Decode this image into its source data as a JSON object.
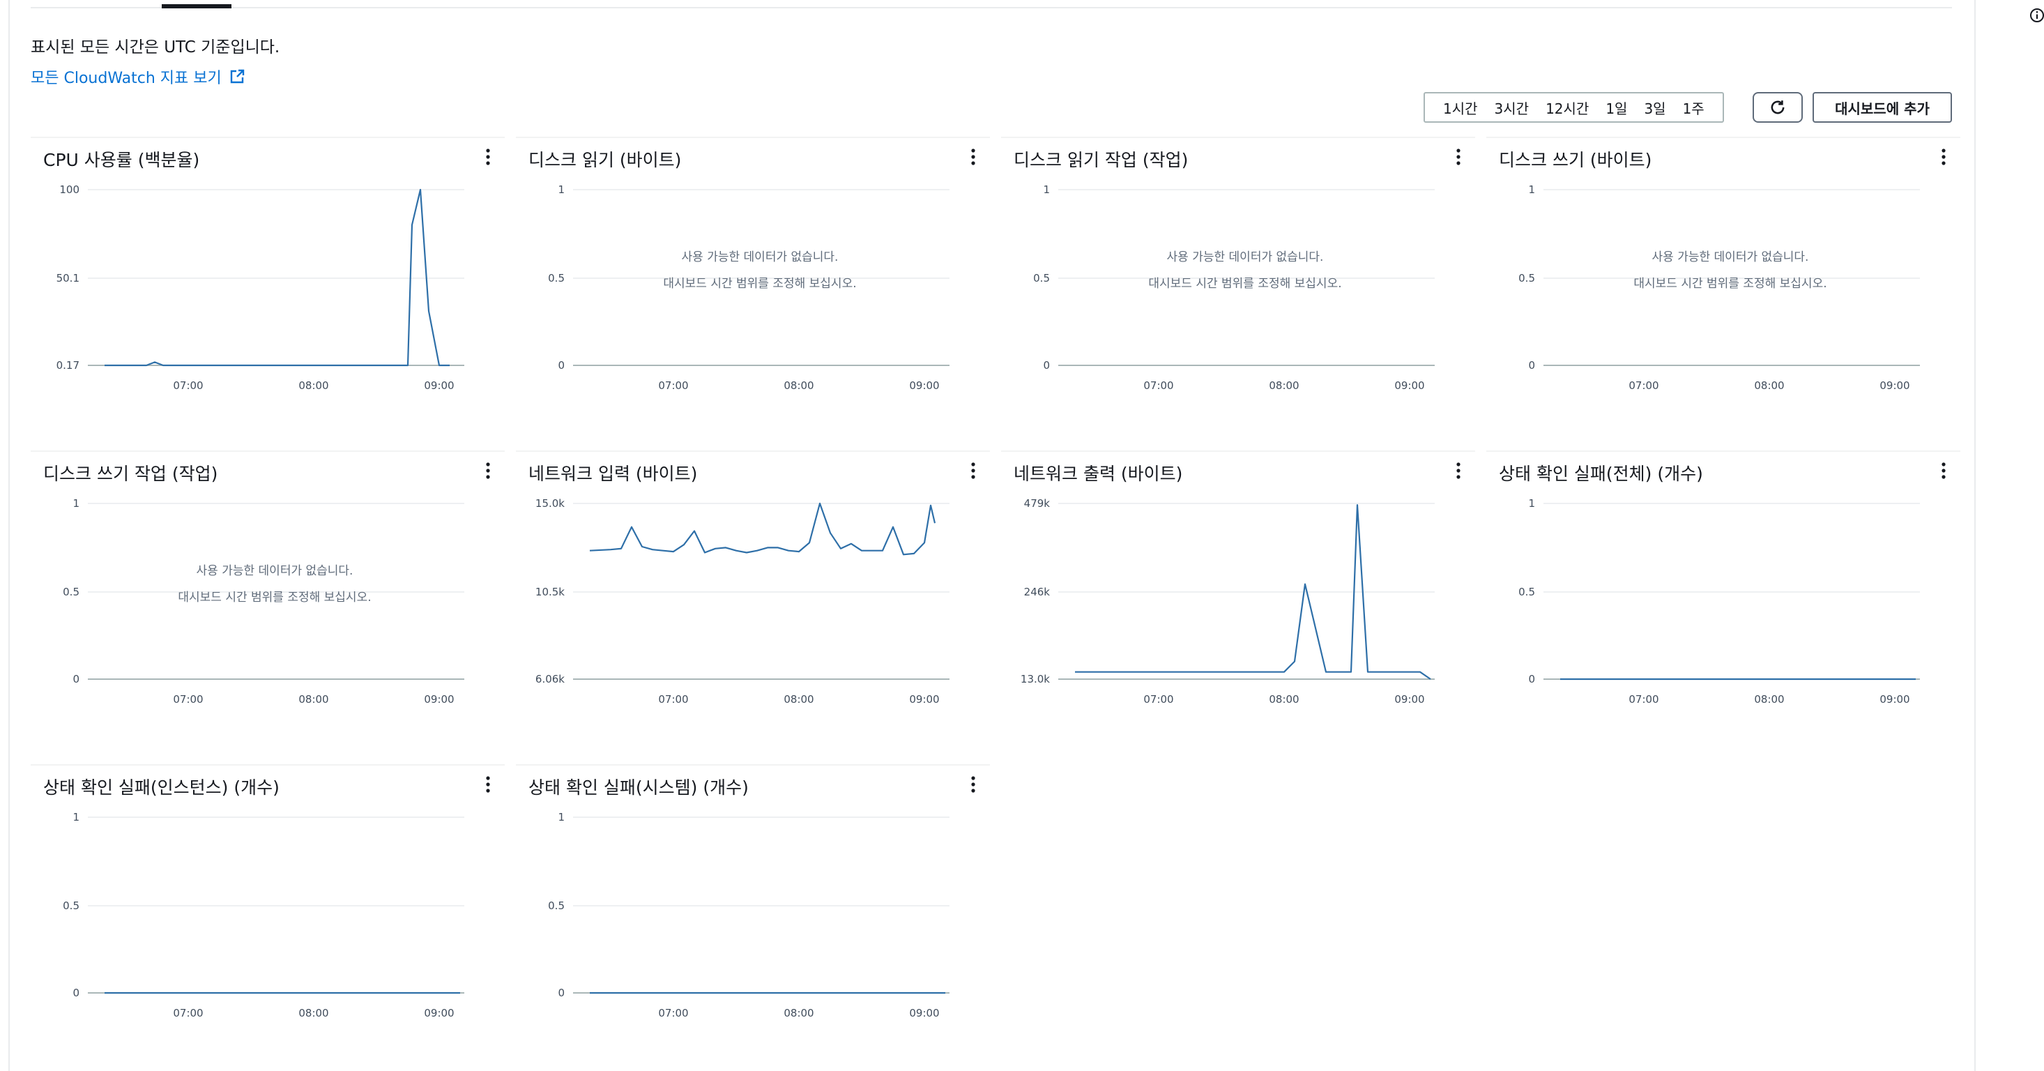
{
  "header": {
    "utc_note": "표시된 모든 시간은 UTC 기준입니다.",
    "all_metrics_link": "모든 CloudWatch 지표 보기"
  },
  "time_range": {
    "options": [
      "1시간",
      "3시간",
      "12시간",
      "1일",
      "3일",
      "1주"
    ]
  },
  "toolbar": {
    "refresh_icon": "refresh-icon",
    "add_to_dashboard_label": "대시보드에 추가"
  },
  "nodata_messages": [
    "사용 가능한 데이터가 없습니다.",
    "대시보드 시간 범위를 조정해 보십시오."
  ],
  "colors": {
    "series": "#2e6fa8",
    "link": "#0972d3",
    "text": "#16191f",
    "axis": "#aab7b8",
    "grid": "#e9ebed"
  },
  "chart_data": [
    {
      "type": "line",
      "title": "CPU 사용률 (백분율)",
      "y_ticks": [
        "100",
        "50.1",
        "0.17"
      ],
      "ylim": [
        0.17,
        100
      ],
      "x_ticks": [
        "07:00",
        "08:00",
        "09:00"
      ],
      "series": [
        {
          "x": [
            "06:20",
            "06:30",
            "06:40",
            "06:44",
            "06:48",
            "06:55",
            "07:00",
            "07:10",
            "07:20",
            "07:30",
            "07:40",
            "07:50",
            "08:00",
            "08:10",
            "08:20",
            "08:30",
            "08:40",
            "08:45",
            "08:47",
            "08:51",
            "08:55",
            "09:00",
            "09:02",
            "09:05"
          ],
          "values": [
            0.17,
            0.17,
            0.17,
            2,
            0.17,
            0.17,
            0.17,
            0.17,
            0.17,
            0.17,
            0.17,
            0.17,
            0.17,
            0.17,
            0.17,
            0.17,
            0.17,
            0.17,
            80,
            100,
            31,
            0.17,
            0.17,
            0.17
          ]
        }
      ],
      "no_data": false
    },
    {
      "type": "line",
      "title": "디스크 읽기 (바이트)",
      "y_ticks": [
        "1",
        "0.5",
        "0"
      ],
      "x_ticks": [
        "07:00",
        "08:00",
        "09:00"
      ],
      "series": [],
      "no_data": true
    },
    {
      "type": "line",
      "title": "디스크 읽기 작업 (작업)",
      "y_ticks": [
        "1",
        "0.5",
        "0"
      ],
      "x_ticks": [
        "07:00",
        "08:00",
        "09:00"
      ],
      "series": [],
      "no_data": true
    },
    {
      "type": "line",
      "title": "디스크 쓰기 (바이트)",
      "y_ticks": [
        "1",
        "0.5",
        "0"
      ],
      "x_ticks": [
        "07:00",
        "08:00",
        "09:00"
      ],
      "series": [],
      "no_data": true
    },
    {
      "type": "line",
      "title": "디스크 쓰기 작업 (작업)",
      "y_ticks": [
        "1",
        "0.5",
        "0"
      ],
      "x_ticks": [
        "07:00",
        "08:00",
        "09:00"
      ],
      "series": [],
      "no_data": true
    },
    {
      "type": "line",
      "title": "네트워크 입력 (바이트)",
      "y_ticks": [
        "15.0k",
        "10.5k",
        "6.06k"
      ],
      "ylim": [
        6060,
        15000
      ],
      "x_ticks": [
        "07:00",
        "08:00",
        "09:00"
      ],
      "series": [
        {
          "x": [
            "06:20",
            "06:30",
            "06:35",
            "06:40",
            "06:45",
            "06:50",
            "06:55",
            "07:00",
            "07:05",
            "07:10",
            "07:15",
            "07:20",
            "07:25",
            "07:30",
            "07:35",
            "07:40",
            "07:45",
            "07:50",
            "07:55",
            "08:00",
            "08:05",
            "08:10",
            "08:15",
            "08:20",
            "08:25",
            "08:30",
            "08:35",
            "08:40",
            "08:45",
            "08:50",
            "08:55",
            "09:00",
            "09:03",
            "09:05"
          ],
          "values": [
            12600,
            12650,
            12700,
            13800,
            12800,
            12650,
            12600,
            12550,
            12900,
            13600,
            12500,
            12700,
            12750,
            12600,
            12500,
            12600,
            12750,
            12750,
            12600,
            12550,
            13000,
            15000,
            13500,
            12700,
            12950,
            12600,
            12600,
            12600,
            13800,
            12400,
            12450,
            13000,
            14900,
            14000
          ]
        }
      ],
      "no_data": false
    },
    {
      "type": "line",
      "title": "네트워크 출력 (바이트)",
      "y_ticks": [
        "479k",
        "246k",
        "13.0k"
      ],
      "ylim": [
        13000,
        479000
      ],
      "x_ticks": [
        "07:00",
        "08:00",
        "09:00"
      ],
      "series": [
        {
          "x": [
            "06:20",
            "06:30",
            "06:40",
            "06:50",
            "07:00",
            "07:10",
            "07:20",
            "07:30",
            "07:40",
            "07:50",
            "07:55",
            "08:00",
            "08:05",
            "08:10",
            "08:20",
            "08:30",
            "08:32",
            "08:35",
            "08:40",
            "08:50",
            "09:00",
            "09:05",
            "09:10"
          ],
          "values": [
            32000,
            32000,
            32000,
            32000,
            32000,
            32000,
            32000,
            32000,
            32000,
            32000,
            32000,
            32000,
            60000,
            265000,
            32000,
            32000,
            32000,
            475000,
            32000,
            32000,
            32000,
            32000,
            13000
          ]
        }
      ],
      "no_data": false
    },
    {
      "type": "line",
      "title": "상태 확인 실패(전체) (개수)",
      "y_ticks": [
        "1",
        "0.5",
        "0"
      ],
      "ylim": [
        0,
        1
      ],
      "x_ticks": [
        "07:00",
        "08:00",
        "09:00"
      ],
      "series": [
        {
          "x": [
            "06:20",
            "09:10"
          ],
          "values": [
            0,
            0
          ]
        }
      ],
      "no_data": false
    },
    {
      "type": "line",
      "title": "상태 확인 실패(인스턴스) (개수)",
      "y_ticks": [
        "1",
        "0.5",
        "0"
      ],
      "ylim": [
        0,
        1
      ],
      "x_ticks": [
        "07:00",
        "08:00",
        "09:00"
      ],
      "series": [
        {
          "x": [
            "06:20",
            "09:10"
          ],
          "values": [
            0,
            0
          ]
        }
      ],
      "no_data": false
    },
    {
      "type": "line",
      "title": "상태 확인 실패(시스템) (개수)",
      "y_ticks": [
        "1",
        "0.5",
        "0"
      ],
      "ylim": [
        0,
        1
      ],
      "x_ticks": [
        "07:00",
        "08:00",
        "09:00"
      ],
      "series": [
        {
          "x": [
            "06:20",
            "09:10"
          ],
          "values": [
            0,
            0
          ]
        }
      ],
      "no_data": false
    }
  ]
}
